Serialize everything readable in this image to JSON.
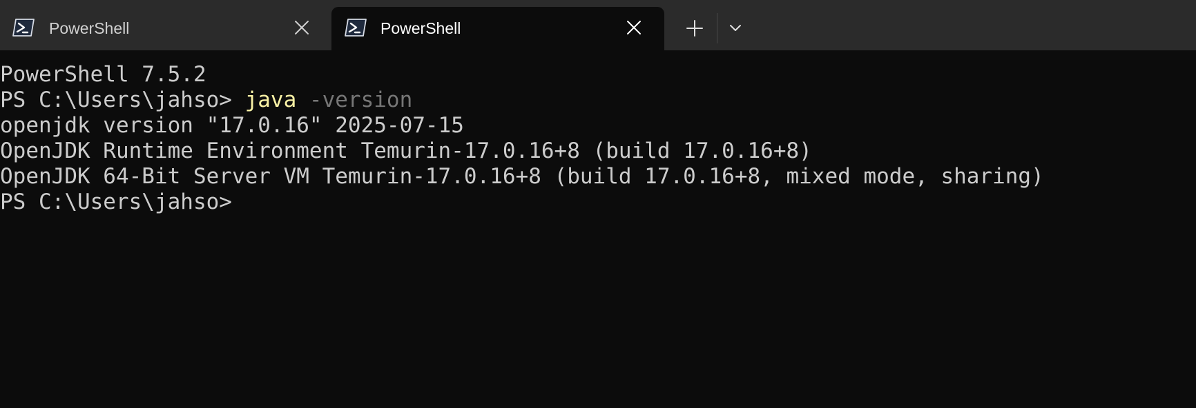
{
  "tabs": [
    {
      "title": "PowerShell",
      "icon": "powershell-icon",
      "active": false
    },
    {
      "title": "PowerShell",
      "icon": "powershell-icon",
      "active": true
    }
  ],
  "toolbar": {
    "new_tab_icon": "plus-icon",
    "dropdown_icon": "chevron-down-icon"
  },
  "terminal": {
    "banner": "PowerShell 7.5.2",
    "prompt1": "PS C:\\Users\\jahso> ",
    "command": "java",
    "argument": " -version",
    "output": [
      "openjdk version \"17.0.16\" 2025-07-15",
      "OpenJDK Runtime Environment Temurin-17.0.16+8 (build 17.0.16+8)",
      "OpenJDK 64-Bit Server VM Temurin-17.0.16+8 (build 17.0.16+8, mixed mode, sharing)"
    ],
    "prompt2": "PS C:\\Users\\jahso>"
  },
  "colors": {
    "background": "#0c0c0c",
    "tabbar": "#2b2b2b",
    "text": "#cccccc",
    "command": "#f9f1a5",
    "argument": "#767676"
  }
}
